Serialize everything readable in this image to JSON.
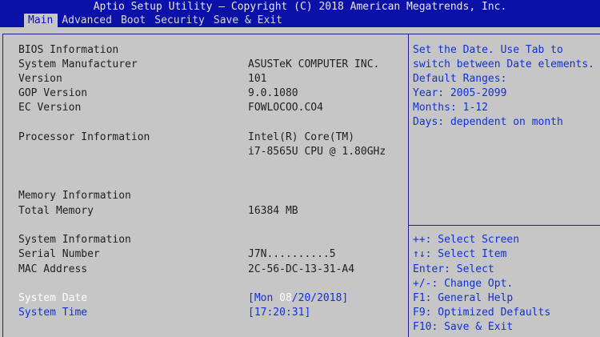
{
  "header": {
    "title": "Aptio Setup Utility – Copyright (C) 2018 American Megatrends, Inc.",
    "tabs": [
      {
        "label": "Main"
      },
      {
        "label": "Advanced"
      },
      {
        "label": "Boot"
      },
      {
        "label": "Security"
      },
      {
        "label": "Save & Exit"
      }
    ]
  },
  "main": {
    "bios_heading": "BIOS Information",
    "rows": [
      {
        "label": "System Manufacturer",
        "value": "ASUSTeK COMPUTER INC."
      },
      {
        "label": "Version",
        "value": "101"
      },
      {
        "label": "GOP Version",
        "value": "9.0.1080"
      },
      {
        "label": "EC Version",
        "value": "FOWLOCOO.CO4"
      }
    ],
    "processor_label": "Processor Information",
    "processor_value_1": "Intel(R) Core(TM)",
    "processor_value_2": "i7-8565U CPU @ 1.80GHz",
    "memory_heading": "Memory Information",
    "total_memory_label": "Total Memory",
    "total_memory_value": "16384 MB",
    "system_heading": "System Information",
    "serial_label": "Serial Number",
    "serial_value": "J7N..........5",
    "mac_label": "MAC Address",
    "mac_value": "2C-56-DC-13-31-A4",
    "date_label": "System Date",
    "date_value_prefix": "[Mon ",
    "date_value_mm": "08",
    "date_value_suffix": "/20/2018]",
    "time_label": "System Time",
    "time_value": "[17:20:31]"
  },
  "help": {
    "lines": [
      "Set the Date. Use Tab to",
      "switch between Date elements.",
      "Default Ranges:",
      "Year: 2005-2099",
      "Months: 1-12",
      "Days: dependent on month"
    ],
    "keys": [
      "++: Select Screen",
      "↑↓: Select Item",
      "Enter: Select",
      "+/-: Change Opt.",
      "F1: General Help",
      "F9: Optimized Defaults",
      "F10: Save & Exit"
    ]
  },
  "colors": {
    "header_bg": "#0a10a8",
    "body_bg": "#c6c6c6",
    "accent_text": "#1030d8"
  }
}
